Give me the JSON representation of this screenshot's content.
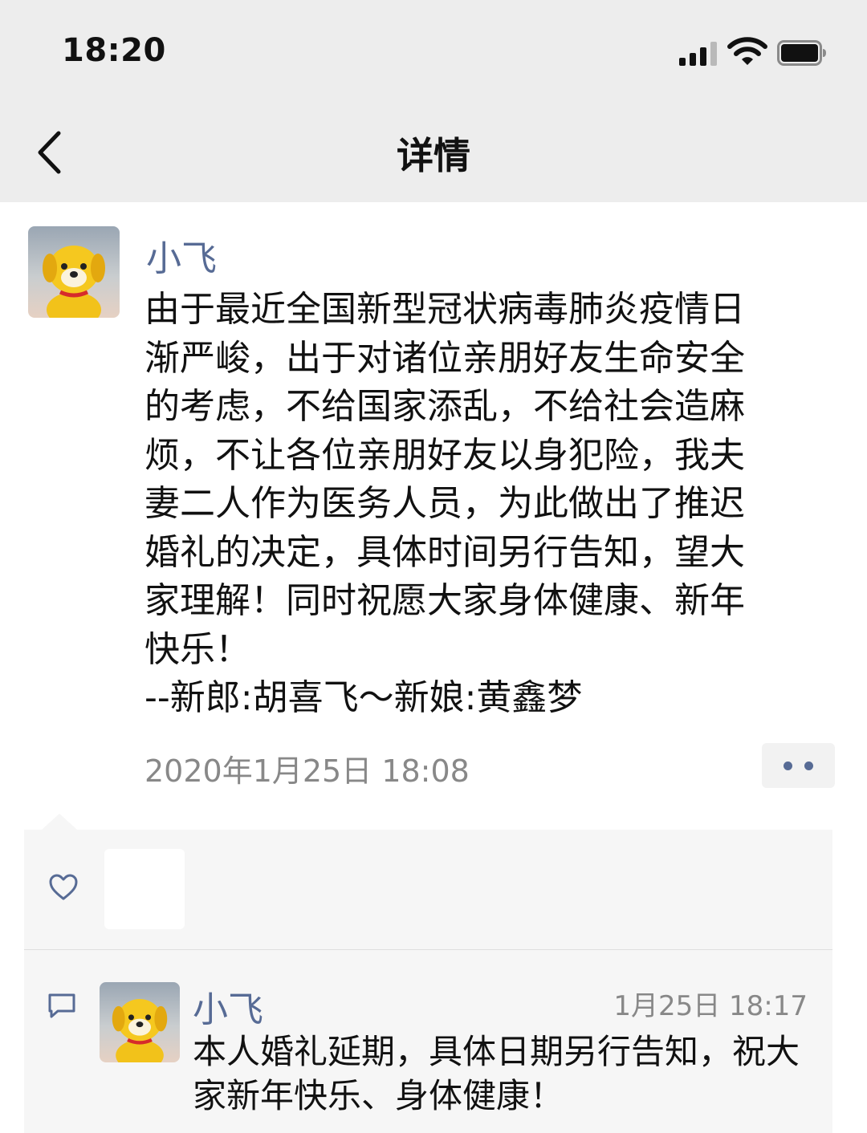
{
  "status_bar": {
    "time": "18:20"
  },
  "nav": {
    "title": "详情",
    "back_icon": "chevron-left-icon"
  },
  "post": {
    "author": "小飞",
    "text": "由于最近全国新型冠状病毒肺炎疫情日\n渐严峻，出于对诸位亲朋好友生命安全\n的考虑，不给国家添乱，不给社会造麻\n烦，不让各位亲朋好友以身犯险，我夫\n妻二人作为医务人员，为此做出了推迟\n婚礼的决定，具体时间另行告知，望大\n家理解！同时祝愿大家身体健康、新年\n快乐！\n--新郎:胡喜飞～新娘:黄鑫梦",
    "time": "2020年1月25日 18:08",
    "more_icon": "more-dots-icon"
  },
  "likes": {
    "icon": "heart-icon"
  },
  "comments": [
    {
      "author": "小飞",
      "time": "1月25日 18:17",
      "text": "本人婚礼延期，具体日期另行告知，祝大家新年快乐、身体健康！",
      "icon": "comment-icon"
    }
  ],
  "colors": {
    "link": "#576b95",
    "panel": "#f6f6f6",
    "topbar": "#ededed",
    "meta": "#888888"
  }
}
